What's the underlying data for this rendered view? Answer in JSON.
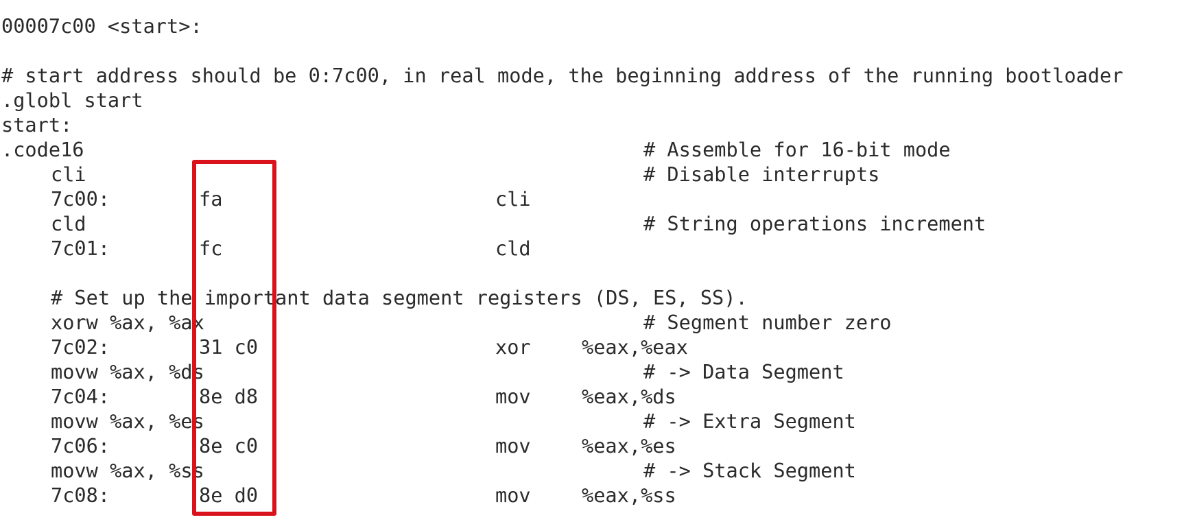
{
  "listing": [
    {
      "kind": "header",
      "text": "00007c00 <start>:"
    },
    {
      "kind": "blank"
    },
    {
      "kind": "comment",
      "text": "# start address should be 0:7c00, in real mode, the beginning address of the running bootloader"
    },
    {
      "kind": "directive",
      "text": ".globl start"
    },
    {
      "kind": "label",
      "text": "start:"
    },
    {
      "kind": "source",
      "indent": false,
      "code": ".code16",
      "comment": "# Assemble for 16-bit mode"
    },
    {
      "kind": "source",
      "indent": true,
      "code": "cli",
      "comment": "# Disable interrupts"
    },
    {
      "kind": "disasm",
      "addr": "7c00:",
      "bytes": "fa",
      "mnemonic": "cli",
      "operands": ""
    },
    {
      "kind": "source",
      "indent": true,
      "code": "cld",
      "comment": "# String operations increment"
    },
    {
      "kind": "disasm",
      "addr": "7c01:",
      "bytes": "fc",
      "mnemonic": "cld",
      "operands": ""
    },
    {
      "kind": "blank"
    },
    {
      "kind": "comment",
      "indent": true,
      "text": "# Set up the important data segment registers (DS, ES, SS)."
    },
    {
      "kind": "source",
      "indent": true,
      "code": "xorw %ax, %ax",
      "comment": "# Segment number zero"
    },
    {
      "kind": "disasm",
      "addr": "7c02:",
      "bytes": "31 c0",
      "mnemonic": "xor",
      "operands": "%eax,%eax"
    },
    {
      "kind": "source",
      "indent": true,
      "code": "movw %ax, %ds",
      "comment": "# -> Data Segment"
    },
    {
      "kind": "disasm",
      "addr": "7c04:",
      "bytes": "8e d8",
      "mnemonic": "mov",
      "operands": "%eax,%ds"
    },
    {
      "kind": "source",
      "indent": true,
      "code": "movw %ax, %es",
      "comment": "# -> Extra Segment"
    },
    {
      "kind": "disasm",
      "addr": "7c06:",
      "bytes": "8e c0",
      "mnemonic": "mov",
      "operands": "%eax,%es"
    },
    {
      "kind": "source",
      "indent": true,
      "code": "movw %ax, %ss",
      "comment": "# -> Stack Segment"
    },
    {
      "kind": "disasm",
      "addr": "7c08:",
      "bytes": "8e d0",
      "mnemonic": "mov",
      "operands": "%eax,%ss"
    }
  ],
  "highlight": {
    "color": "#d9121b",
    "target": "machine-code-bytes-column"
  }
}
